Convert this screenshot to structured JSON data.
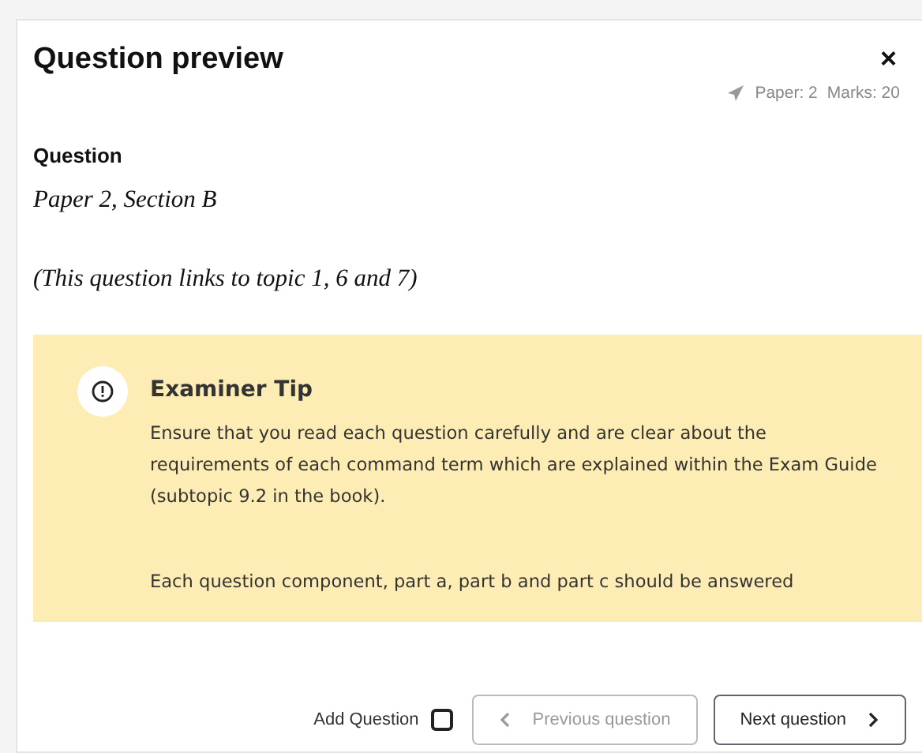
{
  "dialog": {
    "title": "Question preview",
    "close": "×",
    "meta": {
      "paper": "Paper: 2",
      "marks": "Marks: 20"
    }
  },
  "question": {
    "heading": "Question",
    "lines": [
      "Paper 2, Section B",
      "(This question links to topic 1, 6 and 7)"
    ]
  },
  "tip": {
    "title": "Examiner Tip",
    "paragraphs": [
      "Ensure that you read each question carefully and are clear about the requirements of each command term which are explained within the Exam Guide (subtopic 9.2 in the book).",
      "Each question component, part a, part b and part c should be answered"
    ]
  },
  "footer": {
    "add_question": {
      "label": "Add Question",
      "checked": false
    },
    "buttons": [
      {
        "kind": "previous",
        "label": "Previous question",
        "disabled": true
      },
      {
        "kind": "next",
        "label": "Next question",
        "disabled": false
      }
    ]
  }
}
